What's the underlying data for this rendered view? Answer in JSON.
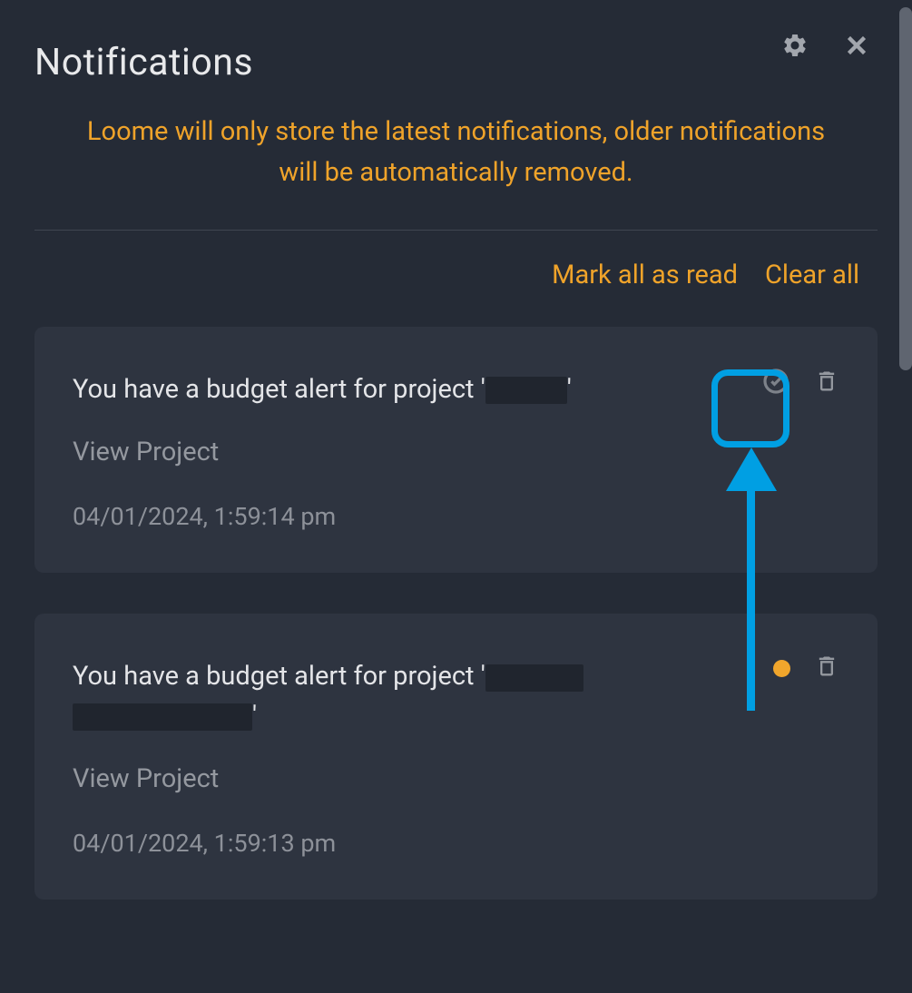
{
  "header": {
    "title": "Notifications"
  },
  "info": "Loome will only store the latest notifications, older notifications will be automatically removed.",
  "actions": {
    "mark_all_read": "Mark all as read",
    "clear_all": "Clear all"
  },
  "notifications": [
    {
      "message_prefix": "You have a budget alert for project '",
      "message_suffix": "'",
      "redacted_widths": [
        90
      ],
      "link": "View Project",
      "timestamp": "04/01/2024, 1:59:14 pm",
      "read": true
    },
    {
      "message_prefix": "You have a budget alert for project '",
      "message_suffix": "'",
      "redacted_widths": [
        108,
        198
      ],
      "link": "View Project",
      "timestamp": "04/01/2024, 1:59:13 pm",
      "read": false
    }
  ],
  "icons": {
    "settings": "gear-icon",
    "close": "close-icon",
    "mark_read": "check-circle-icon",
    "delete": "trash-icon",
    "unread_dot": "unread-dot-icon"
  },
  "annotations": {
    "highlight": "highlight-mark-read-button",
    "arrow": "arrow-pointing-to-mark-read"
  }
}
